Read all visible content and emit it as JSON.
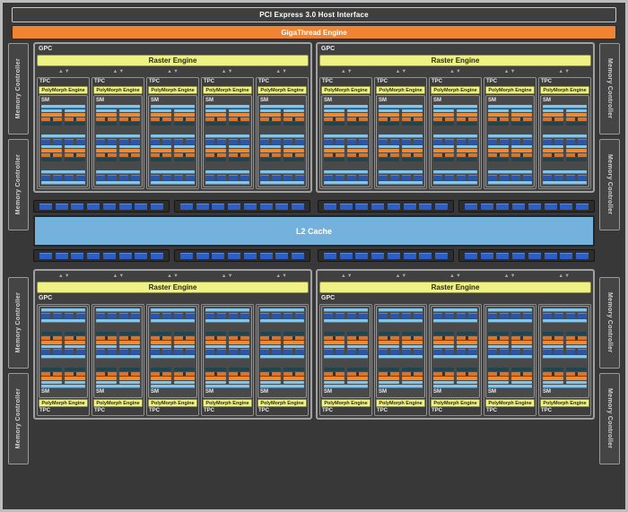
{
  "header": {
    "pci_label": "PCI Express 3.0 Host Interface",
    "gigathread_label": "GigaThread Engine"
  },
  "l2_cache": {
    "label": "L2 Cache"
  },
  "memory": {
    "controller_label": "Memory Controller",
    "controllers_per_side": 4
  },
  "gpc": {
    "label": "GPC",
    "raster_label": "Raster Engine",
    "count": 4,
    "tpcs_per_gpc": 5
  },
  "tpc": {
    "label": "TPC",
    "polymorph_label": "PolyMorph Engine"
  },
  "sm": {
    "label": "SM",
    "partitions": 2,
    "columns_per_partition": 2,
    "core_columns": 4,
    "core_rows": 8,
    "texture_units_per_row": 4
  },
  "interconnect": {
    "rows": 2,
    "groups_per_row": 4,
    "blocks_per_group": 8
  },
  "icons": {
    "up_arrow": "▲",
    "down_arrow": "▼"
  },
  "colors": {
    "gigathread_orange": "#f08432",
    "engine_yellow": "#eef284",
    "core_green": "#2fc42f",
    "l2_blue": "#74b2dd",
    "bar_lightblue": "#84c5ea",
    "scheduler_orange": "#ef8a30",
    "dispatch_orange": "#d9742a",
    "register_teal": "#1f4550",
    "texture_blue": "#2e55a5",
    "interconnect_blue": "#2b5ec6"
  }
}
